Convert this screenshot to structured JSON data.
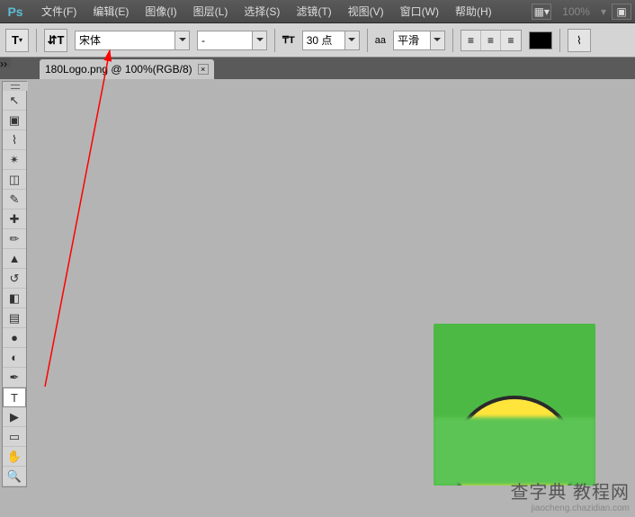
{
  "menu": {
    "items": [
      "文件(F)",
      "编辑(E)",
      "图像(I)",
      "图层(L)",
      "选择(S)",
      "滤镜(T)",
      "视图(V)",
      "窗口(W)",
      "帮助(H)"
    ],
    "zoom": "100%"
  },
  "options": {
    "font_family": "宋体",
    "font_style": "-",
    "font_size": "30 点",
    "antialias": "平滑",
    "aa_prefix": "aa"
  },
  "tab": {
    "title": "180Logo.png @ 100%(RGB/8)"
  },
  "tools": [
    {
      "name": "move-tool",
      "glyph": "↖"
    },
    {
      "name": "marquee-tool",
      "glyph": "▣"
    },
    {
      "name": "lasso-tool",
      "glyph": "⌇"
    },
    {
      "name": "magic-wand-tool",
      "glyph": "✴"
    },
    {
      "name": "crop-tool",
      "glyph": "◫"
    },
    {
      "name": "eyedropper-tool",
      "glyph": "✎"
    },
    {
      "name": "healing-tool",
      "glyph": "✚"
    },
    {
      "name": "brush-tool",
      "glyph": "✏"
    },
    {
      "name": "stamp-tool",
      "glyph": "▲"
    },
    {
      "name": "history-brush-tool",
      "glyph": "↺"
    },
    {
      "name": "eraser-tool",
      "glyph": "◧"
    },
    {
      "name": "gradient-tool",
      "glyph": "▤"
    },
    {
      "name": "blur-tool",
      "glyph": "●"
    },
    {
      "name": "dodge-tool",
      "glyph": "◐"
    },
    {
      "name": "pen-tool",
      "glyph": "✒"
    },
    {
      "name": "type-tool",
      "glyph": "T"
    },
    {
      "name": "path-select-tool",
      "glyph": "▶"
    },
    {
      "name": "shape-tool",
      "glyph": "▭"
    },
    {
      "name": "hand-tool",
      "glyph": "✋"
    },
    {
      "name": "zoom-tool",
      "glyph": "🔍"
    }
  ],
  "watermark": {
    "line1": "查字典 教程网",
    "line2": "jiaocheng.chazidian.com"
  }
}
